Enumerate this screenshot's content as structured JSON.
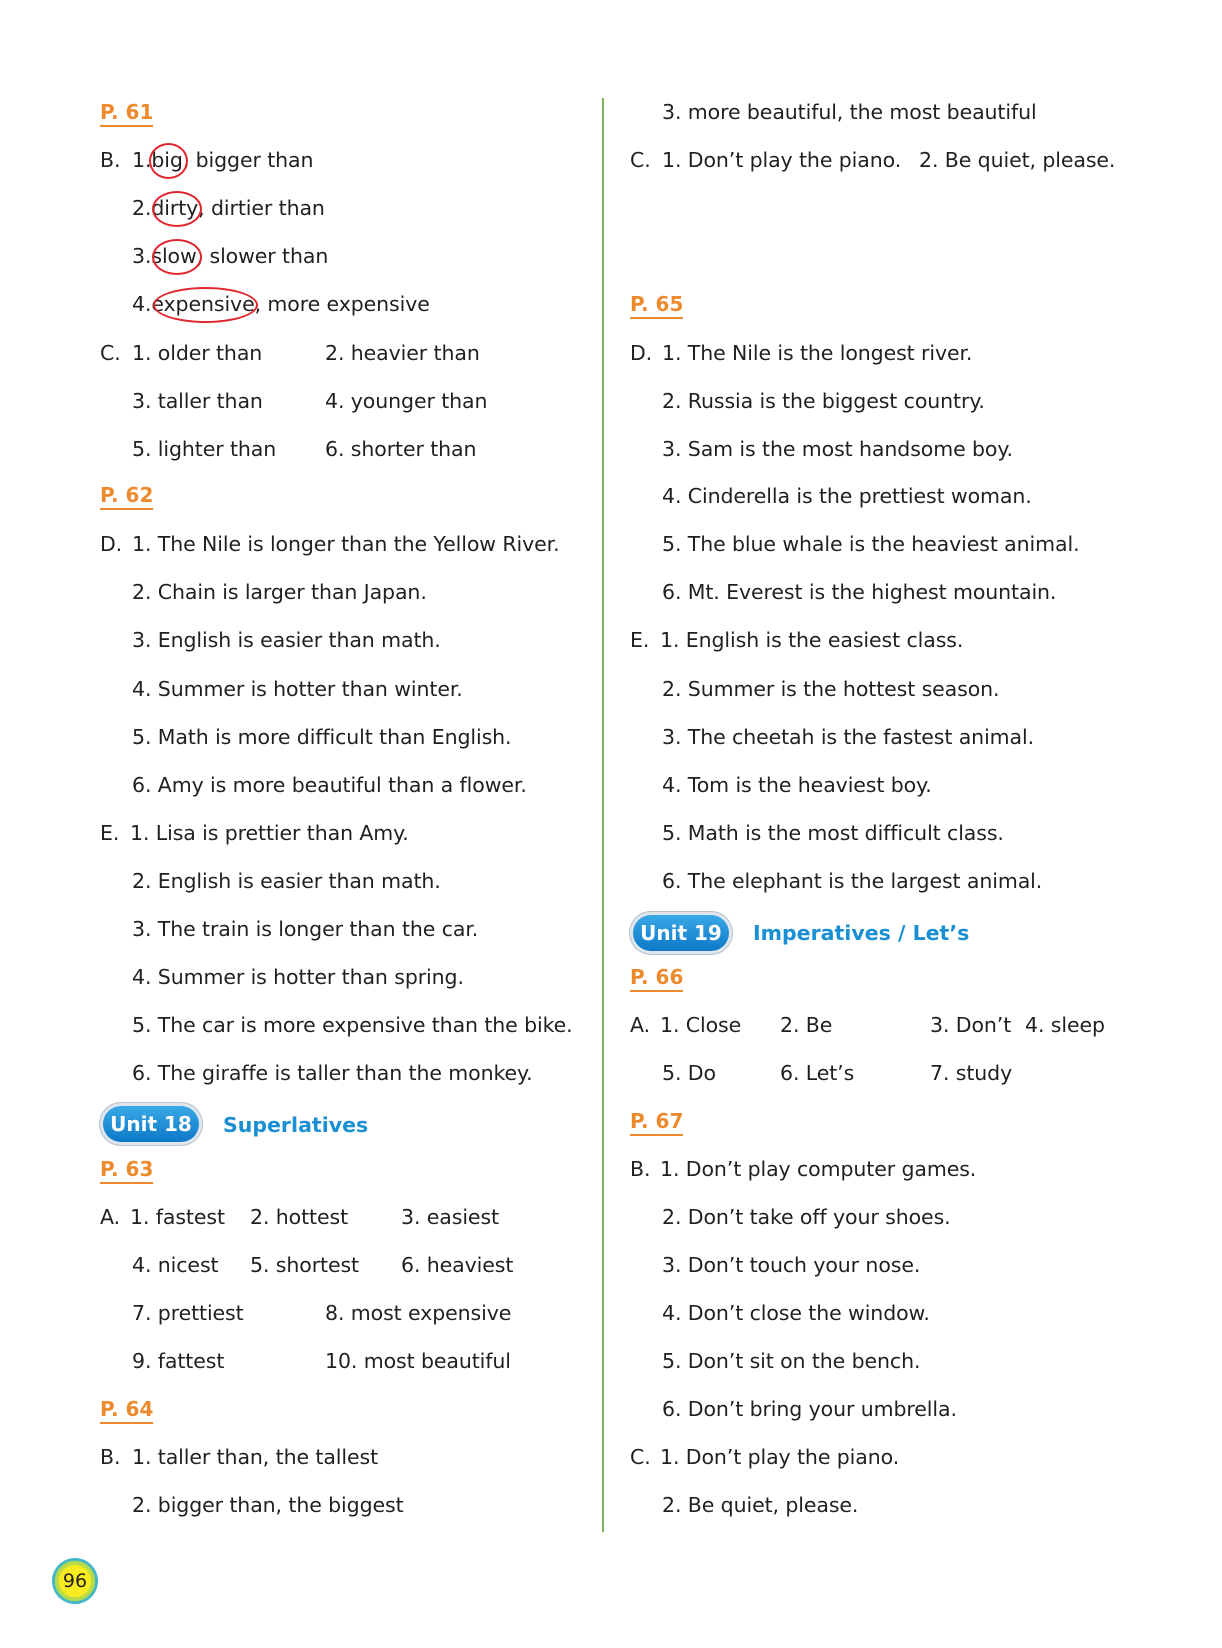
{
  "page_number": "96",
  "colors": {
    "page_ref": "#ee8a2e",
    "unit_blue": "#1a8fd3",
    "divider": "#7fb55a",
    "circle_red": "#e0262d"
  },
  "left": {
    "p61": "P. 61",
    "B": {
      "label": "B.",
      "items": [
        {
          "num": "1.",
          "circled": "big",
          "rest": ", bigger than"
        },
        {
          "num": "2.",
          "circled": "dirty",
          "rest": ", dirtier than"
        },
        {
          "num": "3.",
          "circled": "slow",
          "rest": ", slower than"
        },
        {
          "num": "4.",
          "circled": "expensive",
          "rest": ", more expensive"
        }
      ]
    },
    "C": {
      "label": "C.",
      "items": [
        "1. older than",
        "2. heavier than",
        "3. taller than",
        "4. younger than",
        "5. lighter than",
        "6. shorter than"
      ]
    },
    "p62": "P. 62",
    "D": {
      "label": "D.",
      "items": [
        "1. The Nile is longer than the Yellow River.",
        "2. Chain is larger than Japan.",
        "3. English is easier than math.",
        "4. Summer is hotter than winter.",
        "5. Math is more difficult than English.",
        "6. Amy is more beautiful than a flower."
      ]
    },
    "E": {
      "label": "E.",
      "items": [
        "1. Lisa is prettier than Amy.",
        "2. English is easier than math.",
        "3. The train is longer than the car.",
        "4. Summer is hotter than spring.",
        "5. The car is more expensive than the bike.",
        "6. The giraffe is taller than the monkey."
      ]
    },
    "unit": {
      "badge": "Unit 18",
      "title": "Superlatives"
    },
    "p63": "P. 63",
    "A": {
      "label": "A.",
      "items": [
        "1. fastest",
        "2. hottest",
        "3. easiest",
        "4. nicest",
        "5. shortest",
        "6. heaviest",
        "7. prettiest",
        "8. most expensive",
        "9. fattest",
        "10. most beautiful"
      ]
    },
    "p64": "P. 64",
    "B2": {
      "label": "B.",
      "items": [
        "1. taller than, the tallest",
        "2. bigger than, the biggest"
      ]
    }
  },
  "right": {
    "B2_cont": "3. more beautiful, the most beautiful",
    "C": {
      "label": "C.",
      "items": [
        "1. Don’t play the piano.",
        "2. Be quiet, please."
      ]
    },
    "p65": "P. 65",
    "D": {
      "label": "D.",
      "items": [
        "1. The Nile is the longest river.",
        "2. Russia is the biggest country.",
        "3. Sam is the most handsome boy.",
        "4. Cinderella is the prettiest woman.",
        "5. The blue whale is the heaviest animal.",
        "6. Mt. Everest is the highest mountain."
      ]
    },
    "E": {
      "label": "E.",
      "items": [
        "1. English is the easiest class.",
        "2. Summer is the hottest season.",
        "3. The cheetah is the fastest animal.",
        "4. Tom is the heaviest boy.",
        "5. Math is the most difficult class.",
        "6. The elephant is the largest animal."
      ]
    },
    "unit": {
      "badge": "Unit 19",
      "title": "Imperatives / Let’s"
    },
    "p66": "P. 66",
    "A": {
      "label": "A.",
      "items": [
        "1. Close",
        "2. Be",
        "3. Don’t",
        "4. sleep",
        "5. Do",
        "6. Let’s",
        "7. study"
      ]
    },
    "p67": "P. 67",
    "B": {
      "label": "B.",
      "items": [
        "1. Don’t play computer games.",
        "2. Don’t take off your shoes.",
        "3. Don’t touch your nose.",
        "4. Don’t close the window.",
        "5. Don’t sit on the bench.",
        "6. Don’t bring your umbrella."
      ]
    }
  }
}
